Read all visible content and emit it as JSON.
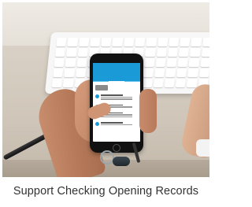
{
  "caption": "Support Checking Opening Records",
  "colors": {
    "app_bar": "#1a9bd7",
    "record_dots": [
      "#1a9bd7",
      "#8a8a8a",
      "#1a9bd7",
      "#1a9bd7"
    ]
  }
}
